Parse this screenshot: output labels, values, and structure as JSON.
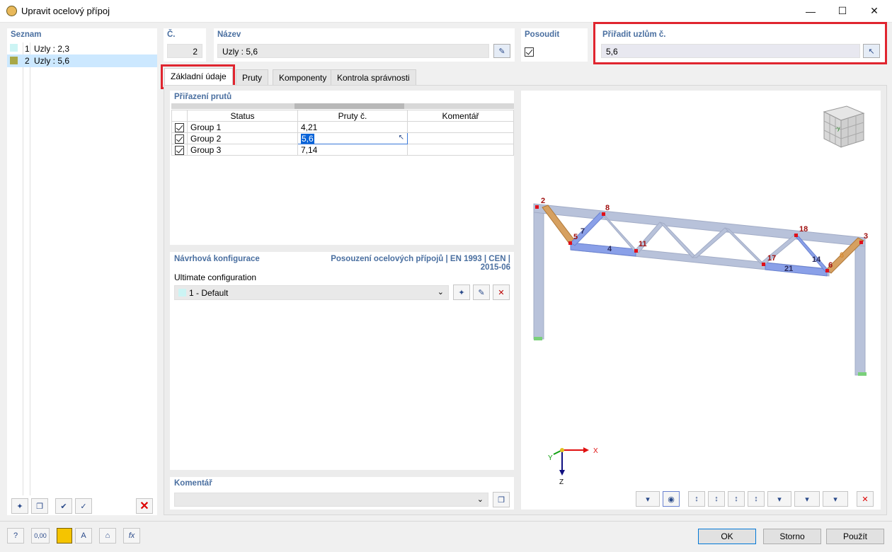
{
  "window": {
    "title": "Upravit ocelový přípoj",
    "minimize": "—",
    "maximize": "☐",
    "close": "✕"
  },
  "list": {
    "header": "Seznam",
    "items": [
      {
        "num": "1",
        "label": "Uzly : 2,3",
        "color": "#ccf4f4"
      },
      {
        "num": "2",
        "label": "Uzly : 5,6",
        "color": "#a8a848"
      }
    ]
  },
  "fields": {
    "number_label": "Č.",
    "number_value": "2",
    "name_label": "Název",
    "name_value": "Uzly : 5,6",
    "check_label": "Posoudit",
    "assign_label": "Přiřadit uzlům č.",
    "assign_value": "5,6"
  },
  "tabs": [
    "Základní údaje",
    "Pruty",
    "Komponenty",
    "Kontrola správnosti"
  ],
  "members": {
    "header": "Přiřazení prutů",
    "columns": [
      "Status",
      "Pruty č.",
      "Komentář"
    ],
    "rows": [
      {
        "status": "Group 1",
        "members": "4,21",
        "comment": ""
      },
      {
        "status": "Group 2",
        "members": "5,6",
        "comment": ""
      },
      {
        "status": "Group 3",
        "members": "7,14",
        "comment": ""
      }
    ]
  },
  "design": {
    "header": "Návrhová konfigurace",
    "standard": "Posouzení ocelových přípojů | EN 1993 | CEN | 2015-06",
    "sub_label": "Ultimate configuration",
    "selected": "1 - Default"
  },
  "comment": {
    "header": "Komentář",
    "value": ""
  },
  "view": {
    "node_labels": [
      "2",
      "8",
      "5",
      "7",
      "11",
      "4",
      "18",
      "3",
      "17",
      "14",
      "21",
      "6",
      "6"
    ],
    "axis_x": "X",
    "axis_y": "Y",
    "axis_z": "Z",
    "cube_label": "-y"
  },
  "buttons": {
    "ok": "OK",
    "cancel": "Storno",
    "apply": "Použít"
  },
  "status": {
    "value_icon": "0,00"
  },
  "colors": {
    "accent": "#4a6fa0",
    "highlight": "#e0252f",
    "selection": "#cce8ff",
    "member": "#aab8d6",
    "member_selected": "#8aa0e8",
    "node": "#e0101a"
  }
}
